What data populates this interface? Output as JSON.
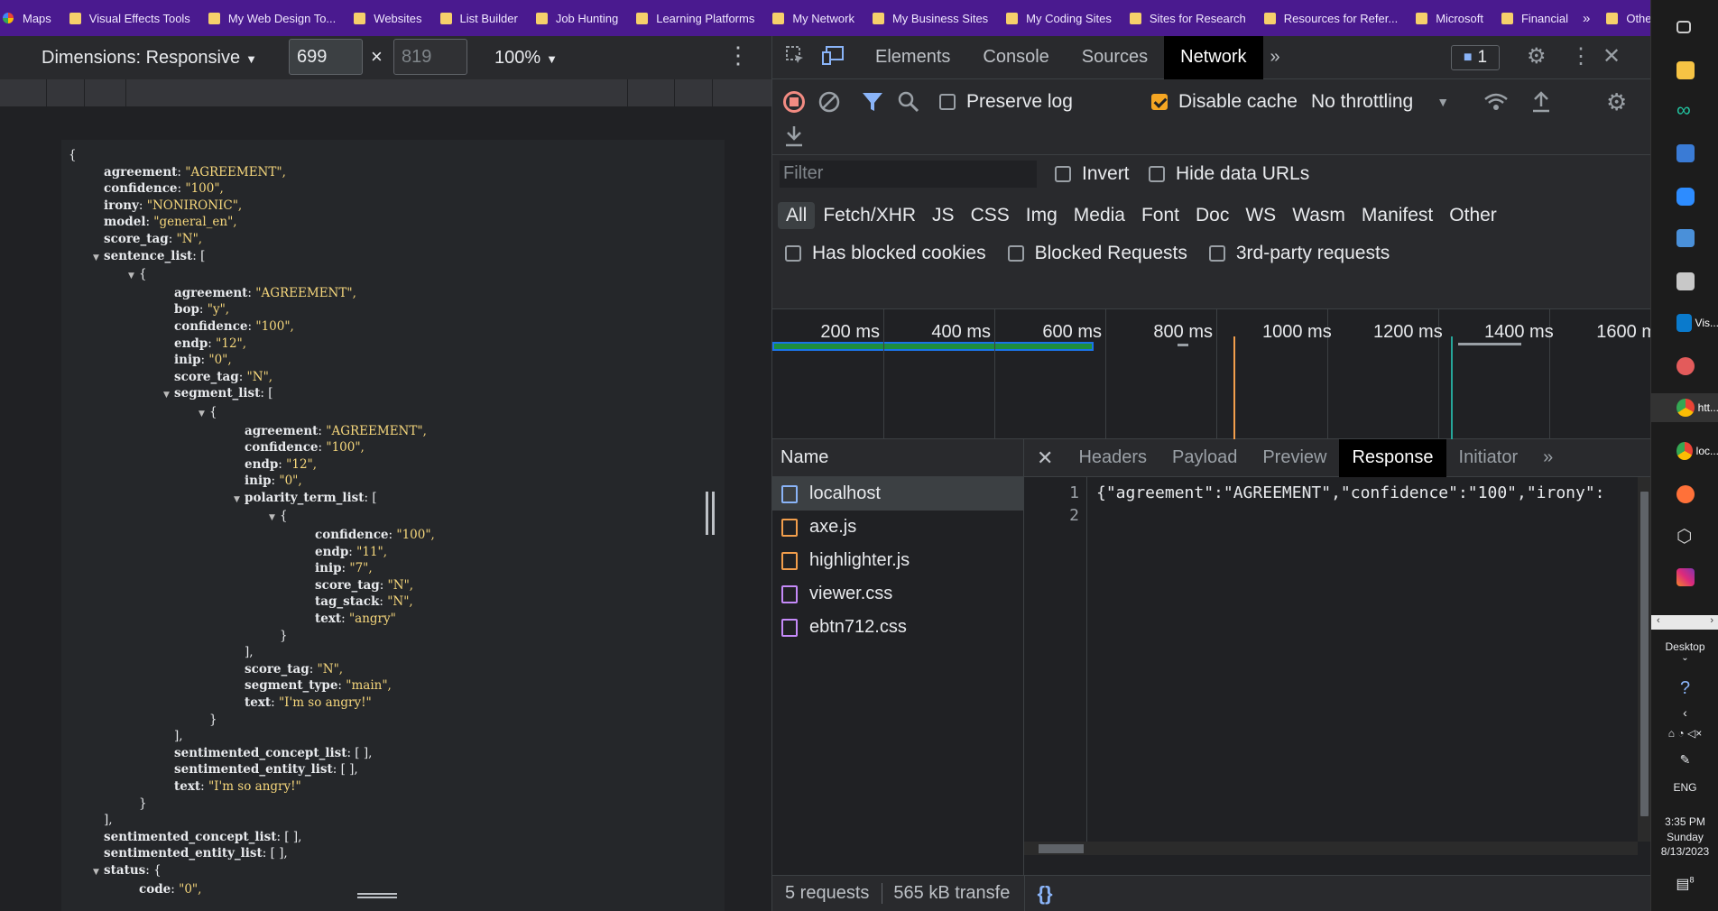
{
  "bookmarks": {
    "items": [
      "Maps",
      "Visual Effects Tools",
      "My Web Design To...",
      "Websites",
      "List Builder",
      "Job Hunting",
      "Learning Platforms",
      "My Network",
      "My Business Sites",
      "My Coding Sites",
      "Sites for Research",
      "Resources for Refer...",
      "Microsoft",
      "Financial"
    ],
    "more": "»",
    "other": "Other bookmarks"
  },
  "emulator": {
    "dimensions_label": "Dimensions: Responsive",
    "width": "699",
    "height": "819",
    "times": "×",
    "zoom": "100%"
  },
  "json_lines": [
    {
      "indent": 0,
      "text": "{"
    },
    {
      "indent": 1,
      "key": "agreement",
      "val": "\"AGREEMENT\","
    },
    {
      "indent": 1,
      "key": "confidence",
      "val": "\"100\","
    },
    {
      "indent": 1,
      "key": "irony",
      "val": "\"NONIRONIC\","
    },
    {
      "indent": 1,
      "key": "model",
      "val": "\"general_en\","
    },
    {
      "indent": 1,
      "key": "score_tag",
      "val": "\"N\","
    },
    {
      "indent": 1,
      "toggle": true,
      "key": "sentence_list",
      "raw": "["
    },
    {
      "indent": 2,
      "toggle": true,
      "text": "{"
    },
    {
      "indent": 3,
      "key": "agreement",
      "val": "\"AGREEMENT\","
    },
    {
      "indent": 3,
      "key": "bop",
      "val": "\"y\","
    },
    {
      "indent": 3,
      "key": "confidence",
      "val": "\"100\","
    },
    {
      "indent": 3,
      "key": "endp",
      "val": "\"12\","
    },
    {
      "indent": 3,
      "key": "inip",
      "val": "\"0\","
    },
    {
      "indent": 3,
      "key": "score_tag",
      "val": "\"N\","
    },
    {
      "indent": 3,
      "toggle": true,
      "key": "segment_list",
      "raw": "["
    },
    {
      "indent": 4,
      "toggle": true,
      "text": "{"
    },
    {
      "indent": 5,
      "key": "agreement",
      "val": "\"AGREEMENT\","
    },
    {
      "indent": 5,
      "key": "confidence",
      "val": "\"100\","
    },
    {
      "indent": 5,
      "key": "endp",
      "val": "\"12\","
    },
    {
      "indent": 5,
      "key": "inip",
      "val": "\"0\","
    },
    {
      "indent": 5,
      "toggle": true,
      "key": "polarity_term_list",
      "raw": "["
    },
    {
      "indent": 6,
      "toggle": true,
      "text": "{"
    },
    {
      "indent": 7,
      "key": "confidence",
      "val": "\"100\","
    },
    {
      "indent": 7,
      "key": "endp",
      "val": "\"11\","
    },
    {
      "indent": 7,
      "key": "inip",
      "val": "\"7\","
    },
    {
      "indent": 7,
      "key": "score_tag",
      "val": "\"N\","
    },
    {
      "indent": 7,
      "key": "tag_stack",
      "val": "\"N\","
    },
    {
      "indent": 7,
      "key": "text",
      "val": "\"angry\""
    },
    {
      "indent": 6,
      "text": "}"
    },
    {
      "indent": 5,
      "text": "],"
    },
    {
      "indent": 5,
      "key": "score_tag",
      "val": "\"N\","
    },
    {
      "indent": 5,
      "key": "segment_type",
      "val": "\"main\","
    },
    {
      "indent": 5,
      "key": "text",
      "val": "\"I'm so angry!\""
    },
    {
      "indent": 4,
      "text": "}"
    },
    {
      "indent": 3,
      "text": "],"
    },
    {
      "indent": 3,
      "key": "sentimented_concept_list",
      "raw": "[ ],"
    },
    {
      "indent": 3,
      "key": "sentimented_entity_list",
      "raw": "[ ],"
    },
    {
      "indent": 3,
      "key": "text",
      "val": "\"I'm so angry!\""
    },
    {
      "indent": 2,
      "text": "}"
    },
    {
      "indent": 1,
      "text": "],"
    },
    {
      "indent": 1,
      "key": "sentimented_concept_list",
      "raw": "[ ],"
    },
    {
      "indent": 1,
      "key": "sentimented_entity_list",
      "raw": "[ ],"
    },
    {
      "indent": 1,
      "toggle": true,
      "key": "status",
      "raw": "{"
    },
    {
      "indent": 2,
      "key": "code",
      "val": "\"0\","
    }
  ],
  "devtools": {
    "tabs": [
      "Elements",
      "Console",
      "Sources",
      "Network"
    ],
    "active_tab": "Network",
    "more_tabs": "»",
    "issues_count": "1",
    "network": {
      "preserve_log": "Preserve log",
      "disable_cache": "Disable cache",
      "throttling": "No throttling",
      "filter_placeholder": "Filter",
      "invert": "Invert",
      "hide_data_urls": "Hide data URLs",
      "types": [
        "All",
        "Fetch/XHR",
        "JS",
        "CSS",
        "Img",
        "Media",
        "Font",
        "Doc",
        "WS",
        "Wasm",
        "Manifest",
        "Other"
      ],
      "active_type": "All",
      "has_blocked_cookies": "Has blocked cookies",
      "blocked_requests": "Blocked Requests",
      "third_party": "3rd-party requests",
      "timeline_labels": [
        "200 ms",
        "400 ms",
        "600 ms",
        "800 ms",
        "1000 ms",
        "1200 ms",
        "1400 ms",
        "1600 m"
      ],
      "name_header": "Name",
      "requests": [
        {
          "name": "localhost",
          "type": "doc"
        },
        {
          "name": "axe.js",
          "type": "js"
        },
        {
          "name": "highlighter.js",
          "type": "js"
        },
        {
          "name": "viewer.css",
          "type": "css"
        },
        {
          "name": "ebtn712.css",
          "type": "css"
        }
      ],
      "detail_tabs": [
        "Headers",
        "Payload",
        "Preview",
        "Response",
        "Initiator"
      ],
      "active_detail_tab": "Response",
      "response_lines": [
        "{\"agreement\":\"AGREEMENT\",\"confidence\":\"100\",\"irony\":",
        ""
      ],
      "status_requests": "5 requests",
      "status_transfer": "565 kB transfe",
      "pretty_print": "{}"
    }
  },
  "taskbar": {
    "vis_label": "Vis...",
    "htt_label": "htt...",
    "loc_label": "loc...",
    "desktop": "Desktop",
    "lang": "ENG",
    "time": "3:35 PM",
    "day": "Sunday",
    "date": "8/13/2023",
    "notif": "8"
  }
}
